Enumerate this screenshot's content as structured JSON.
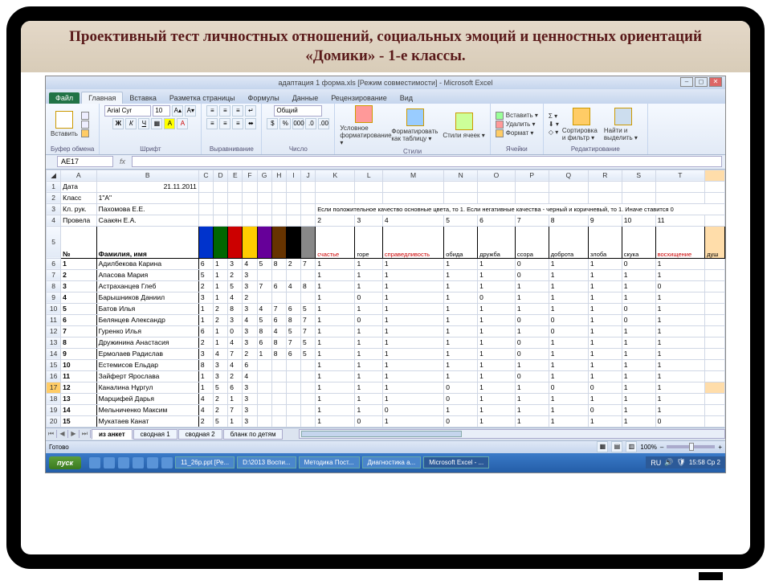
{
  "slide_title": "Проективный тест личностных отношений, социальных эмоций и ценностных ориентаций «Домики» - 1-е классы.",
  "window_title": "адаптация 1 форма.xls [Режим совместимости] - Microsoft Excel",
  "ribbon": {
    "file": "Файл",
    "tabs": [
      "Главная",
      "Вставка",
      "Разметка страницы",
      "Формулы",
      "Данные",
      "Рецензирование",
      "Вид"
    ],
    "groups": {
      "clipboard": "Буфер обмена",
      "font": "Шрифт",
      "align": "Выравнивание",
      "number": "Число",
      "styles": "Стили",
      "cells": "Ячейки",
      "editing": "Редактирование"
    },
    "paste": "Вставить",
    "font_name": "Arial Cyr",
    "font_size": "10",
    "number_format": "Общий",
    "cond_fmt": "Условное форматирование ▾",
    "fmt_table": "Форматировать как таблицу ▾",
    "cell_styles": "Стили ячеек ▾",
    "insert": "Вставить ▾",
    "delete": "Удалить ▾",
    "format": "Формат ▾",
    "sort": "Сортировка и фильтр ▾",
    "find": "Найти и выделить ▾"
  },
  "namebox": "AE17",
  "columns": [
    "A",
    "B",
    "C",
    "D",
    "E",
    "F",
    "G",
    "H",
    "I",
    "J",
    "K",
    "L",
    "M",
    "N",
    "O",
    "P",
    "Q",
    "R",
    "S",
    "T"
  ],
  "meta": {
    "date_lbl": "Дата",
    "date_val": "21.11.2011",
    "class_lbl": "Класс",
    "class_val": "1\"А\"",
    "teacher_lbl": "Кл. рук.",
    "teacher_val": "Пахомова Е.Е.",
    "conductor_lbl": "Провела",
    "conductor_val": "Саакян Е.А.",
    "note": "Если положительное качество основные цвета, то 1. Если негативные качества - черный и коричневый, то 1. Иначе ставится 0"
  },
  "row4_nums": [
    "2",
    "3",
    "4",
    "5",
    "6",
    "7",
    "8",
    "9",
    "10",
    "11"
  ],
  "headers": {
    "no": "№",
    "name": "Фамилия, имя",
    "emotions": [
      "счастье",
      "горе",
      "справедливость",
      "обида",
      "дружба",
      "ссора",
      "доброта",
      "злоба",
      "скука",
      "восхищение",
      "душ"
    ]
  },
  "colors": [
    "#0033cc",
    "#006600",
    "#cc0000",
    "#ffcc00",
    "#660099",
    "#663300",
    "#000000",
    "#888888"
  ],
  "students": [
    {
      "n": "1",
      "name": "Адилбекова Карина",
      "c": [
        "6",
        "1",
        "3",
        "4",
        "5",
        "8",
        "2",
        "7"
      ],
      "e": [
        "1",
        "1",
        "1",
        "1",
        "1",
        "0",
        "1",
        "1",
        "0",
        "1"
      ]
    },
    {
      "n": "2",
      "name": "Апасова  Мария",
      "c": [
        "5",
        "1",
        "2",
        "3",
        "",
        "",
        "",
        ""
      ],
      "e": [
        "1",
        "1",
        "1",
        "1",
        "1",
        "0",
        "1",
        "1",
        "1",
        "1"
      ]
    },
    {
      "n": "3",
      "name": "Астраханцев Глеб",
      "c": [
        "2",
        "1",
        "5",
        "3",
        "7",
        "6",
        "4",
        "8"
      ],
      "e": [
        "1",
        "1",
        "1",
        "1",
        "1",
        "1",
        "1",
        "1",
        "1",
        "0"
      ]
    },
    {
      "n": "4",
      "name": "Барышников Даниил",
      "c": [
        "3",
        "1",
        "4",
        "2",
        "",
        "",
        "",
        ""
      ],
      "e": [
        "1",
        "0",
        "1",
        "1",
        "0",
        "1",
        "1",
        "1",
        "1",
        "1"
      ]
    },
    {
      "n": "5",
      "name": "Батов Илья",
      "c": [
        "1",
        "2",
        "8",
        "3",
        "4",
        "7",
        "6",
        "5"
      ],
      "e": [
        "1",
        "1",
        "1",
        "1",
        "1",
        "1",
        "1",
        "1",
        "0",
        "1"
      ]
    },
    {
      "n": "6",
      "name": "Белянцев Александр",
      "c": [
        "1",
        "2",
        "3",
        "4",
        "5",
        "6",
        "8",
        "7"
      ],
      "e": [
        "1",
        "0",
        "1",
        "1",
        "1",
        "0",
        "0",
        "1",
        "0",
        "1"
      ]
    },
    {
      "n": "7",
      "name": "Гуренко Илья",
      "c": [
        "6",
        "1",
        "0",
        "3",
        "8",
        "4",
        "5",
        "7"
      ],
      "e": [
        "1",
        "1",
        "1",
        "1",
        "1",
        "1",
        "0",
        "1",
        "1",
        "1"
      ]
    },
    {
      "n": "8",
      "name": "Дружинина Анастасия",
      "c": [
        "2",
        "1",
        "4",
        "3",
        "6",
        "8",
        "7",
        "5"
      ],
      "e": [
        "1",
        "1",
        "1",
        "1",
        "1",
        "0",
        "1",
        "1",
        "1",
        "1"
      ]
    },
    {
      "n": "9",
      "name": "Ермолаев Радислав",
      "c": [
        "3",
        "4",
        "7",
        "2",
        "1",
        "8",
        "6",
        "5"
      ],
      "e": [
        "1",
        "1",
        "1",
        "1",
        "1",
        "0",
        "1",
        "1",
        "1",
        "1"
      ]
    },
    {
      "n": "10",
      "name": "Естемисов Ельдар",
      "c": [
        "8",
        "3",
        "4",
        "6",
        "",
        "",
        "",
        ""
      ],
      "e": [
        "1",
        "1",
        "1",
        "1",
        "1",
        "1",
        "1",
        "1",
        "1",
        "1"
      ]
    },
    {
      "n": "11",
      "name": "Зайферт Ярослава",
      "c": [
        "1",
        "3",
        "2",
        "4",
        "",
        "",
        "",
        ""
      ],
      "e": [
        "1",
        "1",
        "1",
        "1",
        "1",
        "0",
        "1",
        "1",
        "1",
        "1"
      ]
    },
    {
      "n": "12",
      "name": "Каналина Нұргул",
      "c": [
        "1",
        "5",
        "6",
        "3",
        "",
        "",
        "",
        ""
      ],
      "e": [
        "1",
        "1",
        "1",
        "0",
        "1",
        "1",
        "0",
        "0",
        "1",
        "1"
      ]
    },
    {
      "n": "13",
      "name": "Марцифей Дарья",
      "c": [
        "4",
        "2",
        "1",
        "3",
        "",
        "",
        "",
        ""
      ],
      "e": [
        "1",
        "1",
        "1",
        "0",
        "1",
        "1",
        "1",
        "1",
        "1",
        "1"
      ]
    },
    {
      "n": "14",
      "name": "Мельниченко Максим",
      "c": [
        "4",
        "2",
        "7",
        "3",
        "",
        "",
        "",
        ""
      ],
      "e": [
        "1",
        "1",
        "0",
        "1",
        "1",
        "1",
        "1",
        "0",
        "1",
        "1"
      ]
    },
    {
      "n": "15",
      "name": "Мукатаев Канат",
      "c": [
        "2",
        "5",
        "1",
        "3",
        "",
        "",
        "",
        ""
      ],
      "e": [
        "1",
        "0",
        "1",
        "0",
        "1",
        "1",
        "1",
        "1",
        "1",
        "0"
      ]
    }
  ],
  "sheets": {
    "tabs": [
      "из анкет",
      "сводная 1",
      "сводная 2",
      "бланк по детям"
    ],
    "active": 0
  },
  "status": {
    "ready": "Готово",
    "zoom": "100%"
  },
  "taskbar": {
    "start": "пуск",
    "items": [
      "11_26p.ppt [Ре...",
      "D:\\2013 Воспи...",
      "Методика Пост...",
      "Диагностика а...",
      "Microsoft Excel - ..."
    ],
    "lang": "RU",
    "clock": "15:58 Ср 2"
  }
}
